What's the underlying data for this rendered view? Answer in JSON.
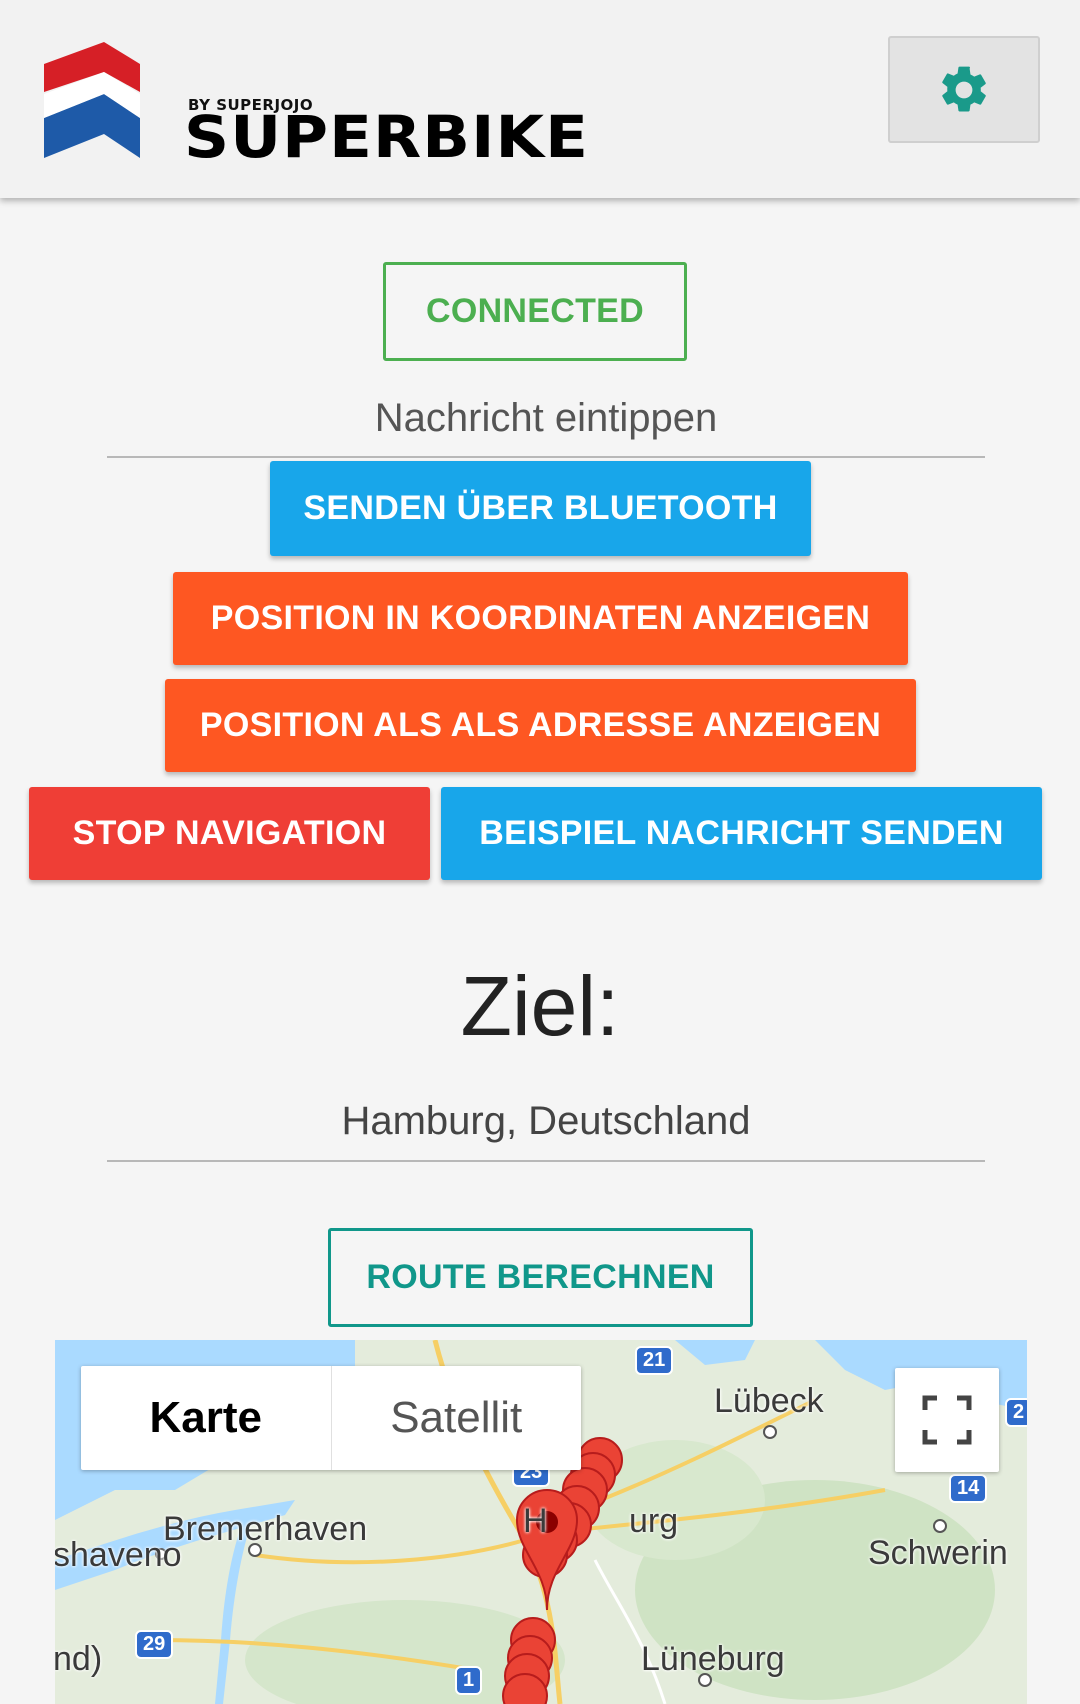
{
  "header": {
    "logo_tagline": "BY SUPERJOJO",
    "logo_word": "SUPERBIKE"
  },
  "status": {
    "label": "CONNECTED"
  },
  "message_field": {
    "placeholder": "Nachricht eintippen"
  },
  "buttons": {
    "send_bluetooth": "SENDEN ÜBER BLUETOOTH",
    "position_coordinates": "POSITION IN KOORDINATEN ANZEIGEN",
    "position_address": "POSITION ALS ALS ADRESSE ANZEIGEN",
    "stop_navigation": "STOP NAVIGATION",
    "send_example": "BEISPIEL NACHRICHT SENDEN",
    "calculate_route": "ROUTE BERECHNEN"
  },
  "destination": {
    "heading": "Ziel:",
    "value": "Hamburg, Deutschland"
  },
  "map": {
    "tabs": [
      "Karte",
      "Satellit"
    ],
    "active_tab": "Karte",
    "cities": {
      "luebeck": "Lübeck",
      "bremerhaven": "Bremerhaven",
      "hamburg_left": "H",
      "hamburg_right": "urg",
      "schwerin": "Schwerin",
      "lueneburg": "Lüneburg",
      "cuxhaven_partial": "shaveno",
      "partial_left": "nd)"
    },
    "route_shields": [
      "21",
      "23",
      "14",
      "29",
      "1",
      "2"
    ]
  },
  "colors": {
    "connected": "#4caf50",
    "blue_button": "#18a6ea",
    "orange_button": "#fe5722",
    "red_button": "#ef3e36",
    "route_button": "#10978a",
    "settings_icon": "#1a9a8a"
  }
}
